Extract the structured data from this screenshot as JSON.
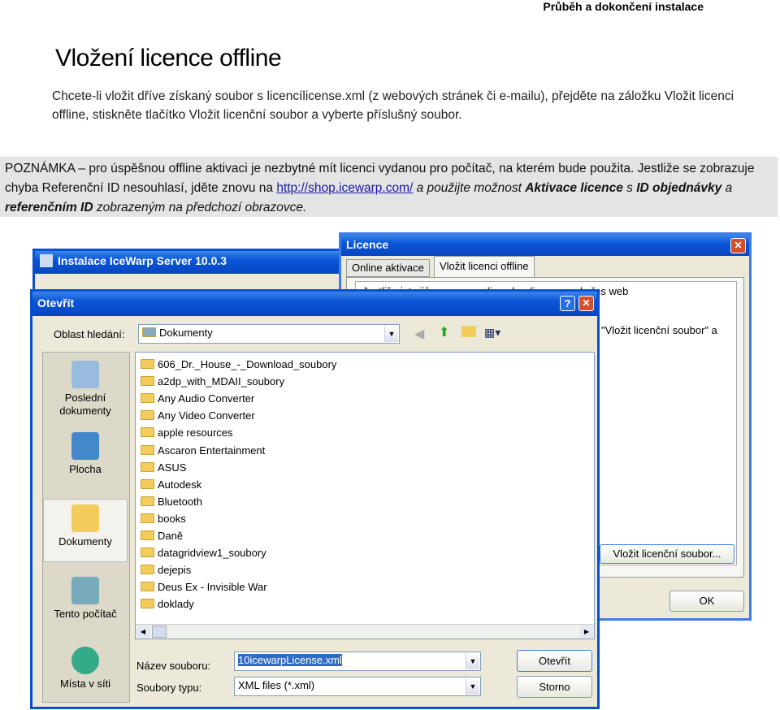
{
  "header": "Průběh a dokončení instalace",
  "title": "Vložení licence offline",
  "paragraph": "Chcete-li vložit dříve získaný soubor s licencílicense.xml (z webových stránek či e-mailu), přejděte na záložku Vložit licenci offline, stiskněte tlačítko Vložit licenční soubor a vyberte příslušný soubor.",
  "note": {
    "part1": "POZNÁMKA – pro úspěšnou offline aktivaci je nezbytné mít licenci vydanou pro počítač, na kterém bude použita. Jestliže se zobrazuje chyba Referenční ID nesouhlasí, jděte znovu na ",
    "link": "http://shop.icewarp.com/",
    "part2": " a použijte možnost ",
    "bold1": "Aktivace licence",
    "part3": " s ",
    "bold2": "ID objednávky",
    "part4": " a ",
    "bold3": "referenčním ID",
    "part5": " zobrazeným na předchozí obrazovce."
  },
  "installer": {
    "title": "Instalace IceWarp Server 10.0.3"
  },
  "licence": {
    "title": "Licence",
    "tabs": [
      "Online aktivace",
      "Vložit licenci offline"
    ],
    "text1": "Jestliže jste již vygenerovali soubor license.xml přes web",
    "text2": "\"Vložit licenční soubor\" a",
    "insert_button": "Vložit licenční soubor...",
    "ok_button": "OK"
  },
  "open": {
    "title": "Otevřít",
    "look_in_label": "Oblast hledání:",
    "look_in_value": "Dokumenty",
    "places": [
      "Poslední dokumenty",
      "Plocha",
      "Dokumenty",
      "Tento počítač",
      "Místa v síti"
    ],
    "files": [
      "606_Dr._House_-_Download_soubory",
      "a2dp_with_MDAII_soubory",
      "Any Audio Converter",
      "Any Video Converter",
      "apple resources",
      "Ascaron Entertainment",
      "ASUS",
      "Autodesk",
      "Bluetooth",
      "books",
      "Daně",
      "datagridview1_soubory",
      "dejepis",
      "Deus Ex - Invisible War",
      "doklady"
    ],
    "filename_label": "Název souboru:",
    "filename_value": "10icewarpLicense.xml",
    "filetype_label": "Soubory typu:",
    "filetype_value": "XML files (*.xml)",
    "open_button": "Otevřít",
    "cancel_button": "Storno"
  }
}
